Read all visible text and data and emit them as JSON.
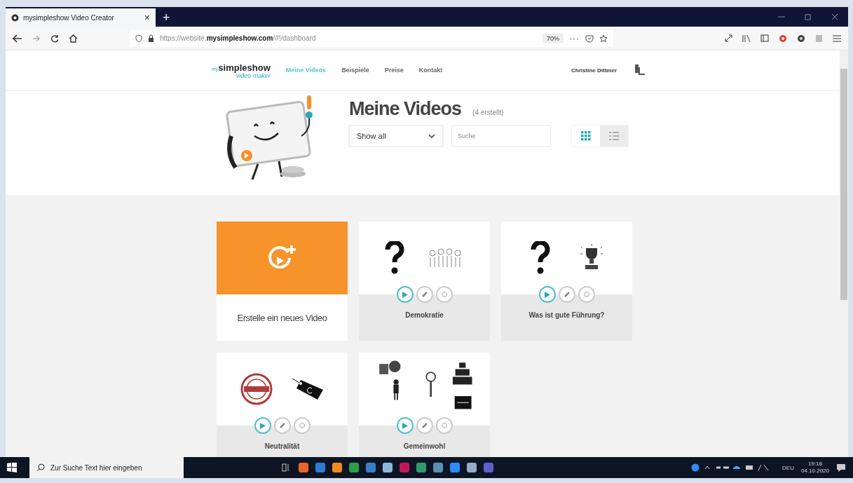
{
  "browser": {
    "tab_title": "mysimpleshow Video Creator",
    "tab_close": "×",
    "new_tab": "+",
    "url_prefix": "https://website.",
    "url_domain": "mysimpleshow.com",
    "url_path": "/#!/dashboard",
    "zoom": "70%",
    "more": "···"
  },
  "site": {
    "logo_prefix": "my",
    "logo": "simpleshow",
    "logo_sub": "video maker",
    "nav": [
      {
        "label": "Meine Videos",
        "selected": true
      },
      {
        "label": "Beispiele",
        "selected": false
      },
      {
        "label": "Preise",
        "selected": false
      },
      {
        "label": "Kontakt",
        "selected": false
      }
    ],
    "user": "Christine Dittmer"
  },
  "header": {
    "title": "Meine Videos",
    "count": "(4 erstellt)",
    "filter": "Show all",
    "search": {
      "placeholder": "Suche"
    },
    "views": [
      {
        "kind": "grid",
        "selected": true
      },
      {
        "kind": "list",
        "selected": false
      }
    ]
  },
  "cards": [
    {
      "kind": "create",
      "title": "Erstelle ein neues Video"
    },
    {
      "kind": "crowd",
      "title": "Demokratie"
    },
    {
      "kind": "trophy",
      "title": "Was ist gute Führung?"
    },
    {
      "kind": "stamp",
      "title": "Neutralität"
    },
    {
      "kind": "mix",
      "title": "Gemeinwohl"
    }
  ],
  "taskbar": {
    "search": {
      "placeholder": "Zur Suche Text hier eingeben"
    },
    "apps": [
      {
        "color": "#e8662a"
      },
      {
        "color": "#2f7bd1"
      },
      {
        "color": "#f08a1c"
      },
      {
        "color": "#2b9c4a"
      },
      {
        "color": "#3a7fc4"
      },
      {
        "color": "#8bb7d8"
      },
      {
        "color": "#c2185b"
      },
      {
        "color": "#2e9b6a"
      },
      {
        "color": "#5a8fb0"
      },
      {
        "color": "#2d8cff"
      },
      {
        "color": "#9aa9c6"
      },
      {
        "color": "#5b5fc7"
      }
    ],
    "lang": "DEU",
    "time": "19:18",
    "date": "04.10.2020"
  }
}
